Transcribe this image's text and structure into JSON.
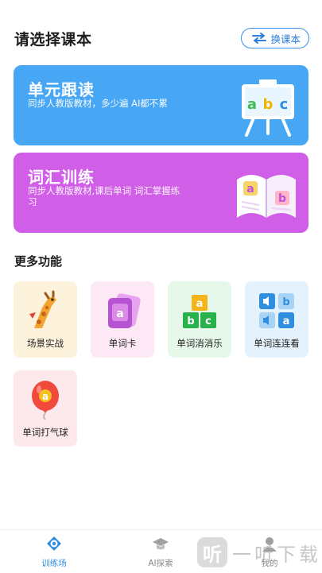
{
  "header": {
    "title": "请选择课本",
    "switch_label": "换课本"
  },
  "cards": [
    {
      "title": "单元跟读",
      "subtitle": "同步人教版教材，多少遍 AI都不累",
      "color": "#47a7f5",
      "icon": "abc-easel-icon",
      "easel_text": [
        "a",
        "b",
        "c"
      ]
    },
    {
      "title": "词汇训练",
      "subtitle": "同步人教版教材,课后单词 词汇掌握练习",
      "color": "#d05ee6",
      "icon": "open-book-icon",
      "book_text": [
        "a",
        "b"
      ]
    }
  ],
  "section_title": "更多功能",
  "features": [
    {
      "label": "场景实战",
      "icon": "giraffe-icon",
      "bg": "#fdf3dc"
    },
    {
      "label": "单词卡",
      "icon": "word-card-icon",
      "bg": "#fde8f6",
      "glyph": "a"
    },
    {
      "label": "单词消消乐",
      "icon": "blocks-icon",
      "bg": "#e5f8ea",
      "glyphs": [
        "a",
        "b",
        "c"
      ]
    },
    {
      "label": "单词连连看",
      "icon": "match-grid-icon",
      "bg": "#e3f2fd",
      "glyphs": [
        "b",
        "a"
      ]
    },
    {
      "label": "单词打气球",
      "icon": "balloon-icon",
      "bg": "#fde9ec",
      "glyph": "a"
    }
  ],
  "nav": [
    {
      "label": "训练场",
      "icon": "target-icon",
      "active": true
    },
    {
      "label": "AI探索",
      "icon": "graduation-cap-icon",
      "active": false
    },
    {
      "label": "我的",
      "icon": "user-icon",
      "active": false
    }
  ],
  "watermark": {
    "logo": "听",
    "text": "一听下载"
  }
}
